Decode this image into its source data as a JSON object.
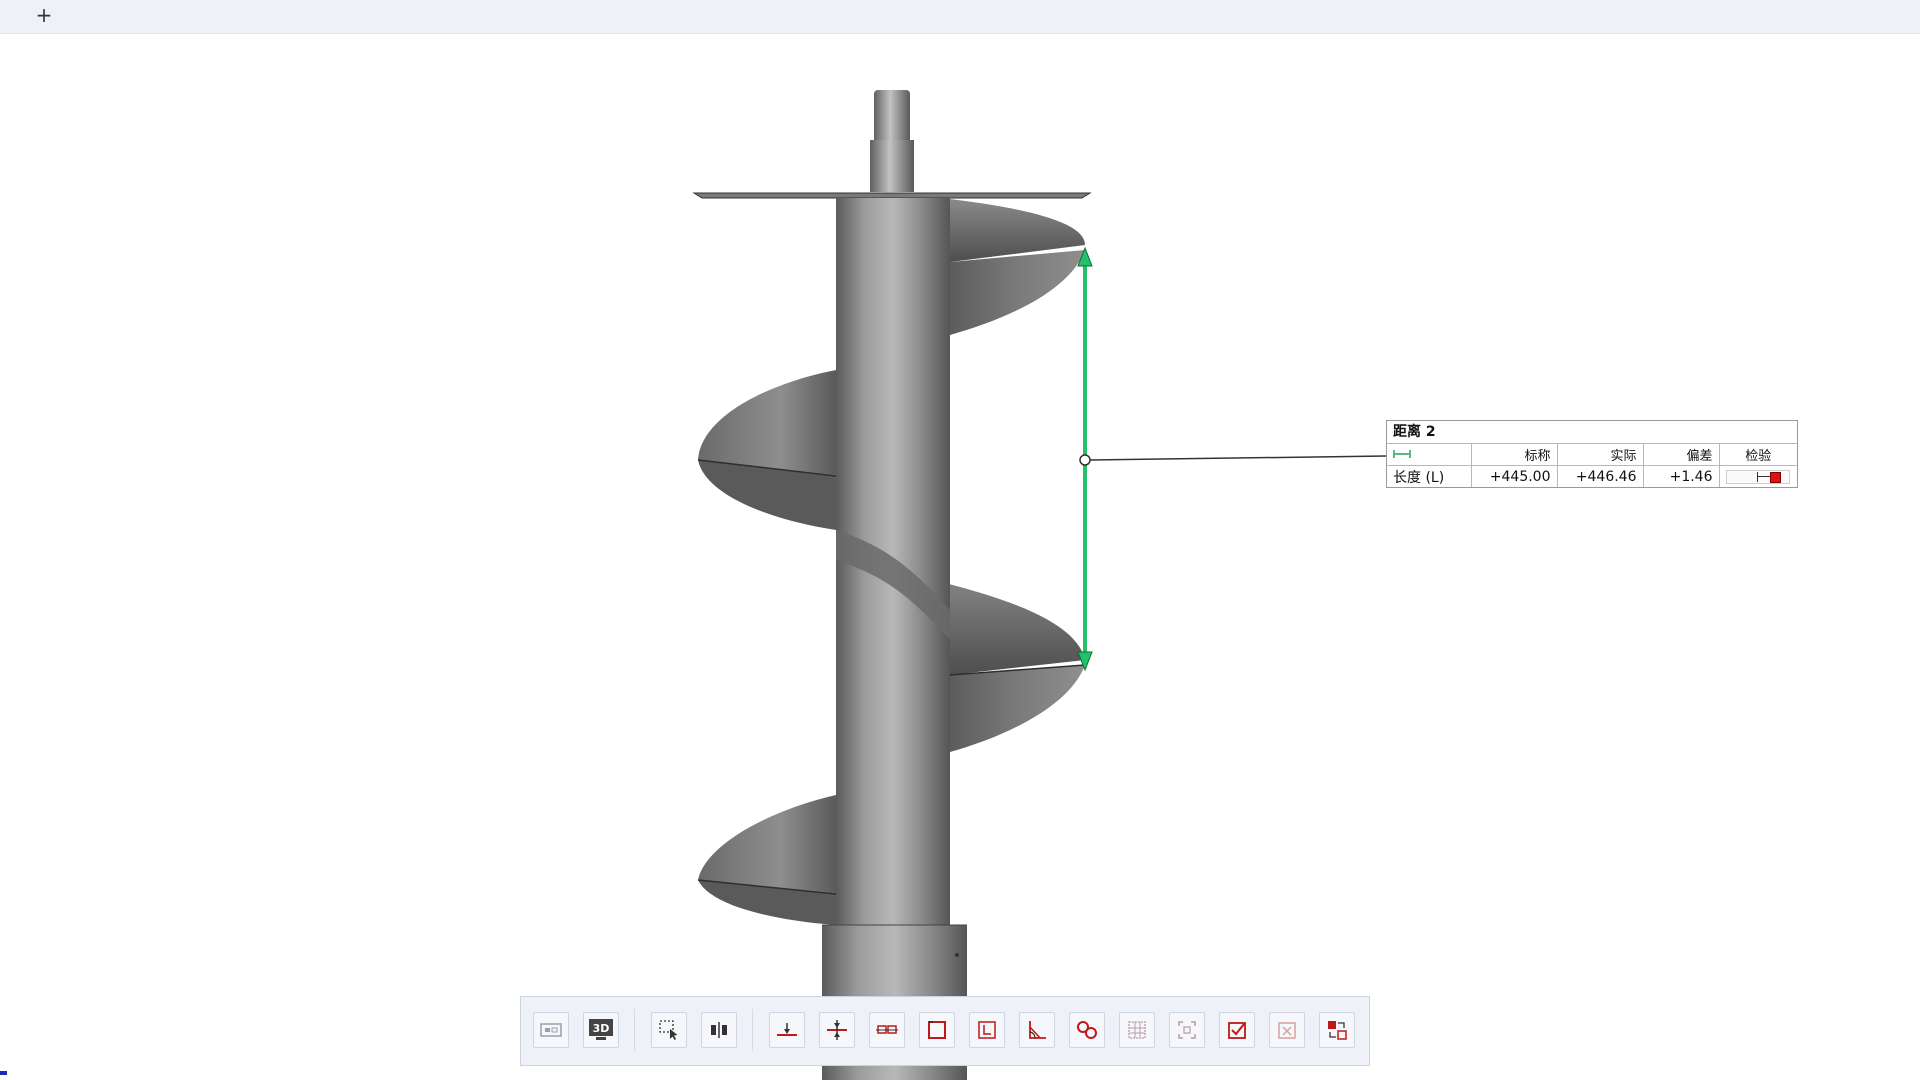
{
  "tabbar": {
    "add_tab_label": "+"
  },
  "measurement": {
    "title": "距离 2",
    "columns": [
      "标称",
      "实际",
      "偏差",
      "检验"
    ],
    "rows": [
      {
        "label": "长度 (L)",
        "nominal": "+445.00",
        "actual": "+446.46",
        "deviation": "+1.46",
        "check_fraction": 0.85
      }
    ],
    "accent_color": "#22c26a",
    "out_of_tolerance_color": "#e01010"
  },
  "toolbar": {
    "buttons": [
      {
        "id": "view-2d",
        "icon": "view-2d-icon"
      },
      {
        "id": "view-3d",
        "icon": "view-3d-icon",
        "label": "3D"
      },
      {
        "id": "select",
        "icon": "select-region-icon"
      },
      {
        "id": "mirror",
        "icon": "mirror-icon"
      },
      {
        "id": "point-align",
        "icon": "point-align-icon"
      },
      {
        "id": "point-center",
        "icon": "point-center-icon"
      },
      {
        "id": "distance",
        "icon": "distance-icon"
      },
      {
        "id": "rectangle",
        "icon": "rectangle-icon"
      },
      {
        "id": "frame",
        "icon": "frame-icon"
      },
      {
        "id": "angle",
        "icon": "angle-icon"
      },
      {
        "id": "circles",
        "icon": "circles-icon"
      },
      {
        "id": "grid",
        "icon": "grid-icon"
      },
      {
        "id": "fit",
        "icon": "fit-icon"
      },
      {
        "id": "check",
        "icon": "check-icon"
      },
      {
        "id": "delete",
        "icon": "delete-icon"
      },
      {
        "id": "transform",
        "icon": "transform-icon"
      }
    ]
  }
}
